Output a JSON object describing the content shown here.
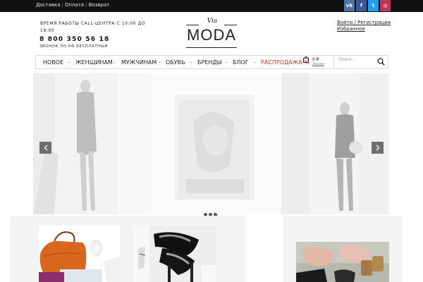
{
  "topbar": {
    "links": [
      "Доставка",
      "Оплата",
      "Возврат"
    ],
    "social": [
      {
        "name": "vk",
        "glyph": "vk",
        "color": "#4a76a8"
      },
      {
        "name": "facebook",
        "glyph": "f",
        "color": "#3b5998"
      },
      {
        "name": "twitter",
        "glyph": "t",
        "color": "#1da1f2"
      },
      {
        "name": "instagram",
        "glyph": "◎",
        "color": "#c1355b"
      }
    ]
  },
  "header": {
    "hours_text": "ВРЕМЯ РАБОТЫ CALL-ЦЕНТРА С 10:00 ДО 19:00",
    "phone": "8 800 350 56 18",
    "call_note": "ЗВОНОК ПО РФ БЕСПЛАТНЫЙ",
    "logo_top": "Via",
    "logo_main": "MODA",
    "login_link": "Войти / Регистрация",
    "favorites_link": "Избранное"
  },
  "nav": {
    "items": [
      "НОВОЕ",
      "ЖЕНЩИНАМ",
      "МУЖЧИНАМ",
      "ОБУВЬ",
      "БРЕНДЫ",
      "БЛОГ",
      "РАСПРОДАЖА %"
    ],
    "cart_sum": "0 ₽",
    "cart_label": "Заказов",
    "search_placeholder": "Поиск..."
  },
  "slider": {
    "prev_icon": "chevron-left-icon",
    "next_icon": "chevron-right-icon",
    "dots": 3
  },
  "colors": {
    "sale": "#c0392b",
    "topbar": "#111111"
  }
}
